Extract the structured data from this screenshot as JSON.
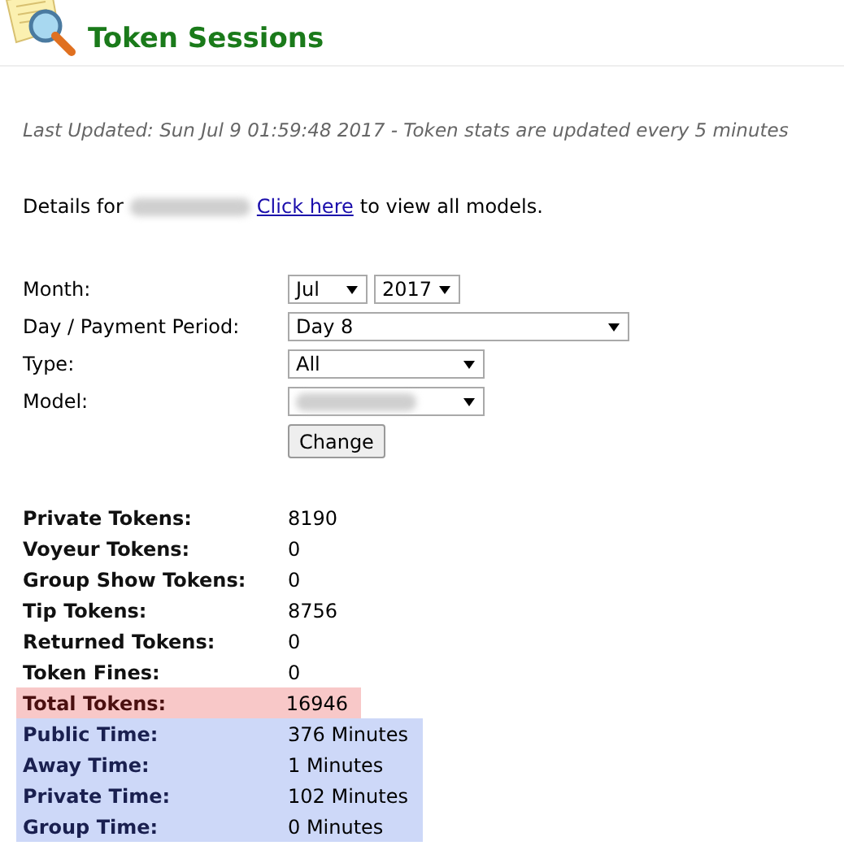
{
  "header": {
    "title": "Token Sessions"
  },
  "last_updated": "Last Updated: Sun Jul 9 01:59:48 2017 - Token stats are updated every 5 minutes",
  "details": {
    "prefix": "Details for",
    "link": "Click here",
    "suffix": "to view all models."
  },
  "form": {
    "fields": [
      {
        "label": "Month:",
        "selects": [
          {
            "value": "Jul"
          },
          {
            "value": "2017"
          }
        ]
      },
      {
        "label": "Day / Payment Period:",
        "selects": [
          {
            "value": "Day 8"
          }
        ]
      },
      {
        "label": "Type:",
        "selects": [
          {
            "value": "All"
          }
        ]
      },
      {
        "label": "Model:",
        "selects": [
          {
            "redacted": true
          }
        ]
      }
    ],
    "button": "Change"
  },
  "stats": [
    {
      "label": "Private Tokens:",
      "value": "8190",
      "kind": "plain"
    },
    {
      "label": "Voyeur Tokens:",
      "value": "0",
      "kind": "plain"
    },
    {
      "label": "Group Show Tokens:",
      "value": "0",
      "kind": "plain"
    },
    {
      "label": "Tip Tokens:",
      "value": "8756",
      "kind": "plain"
    },
    {
      "label": "Returned Tokens:",
      "value": "0",
      "kind": "plain"
    },
    {
      "label": "Token Fines:",
      "value": "0",
      "kind": "plain"
    },
    {
      "label": "Total Tokens:",
      "value": "16946",
      "kind": "total"
    },
    {
      "label": "Public Time:",
      "value": "376 Minutes",
      "kind": "time"
    },
    {
      "label": "Away Time:",
      "value": "1 Minutes",
      "kind": "time"
    },
    {
      "label": "Private Time:",
      "value": "102 Minutes",
      "kind": "time"
    },
    {
      "label": "Group Time:",
      "value": "0 Minutes",
      "kind": "time"
    }
  ]
}
